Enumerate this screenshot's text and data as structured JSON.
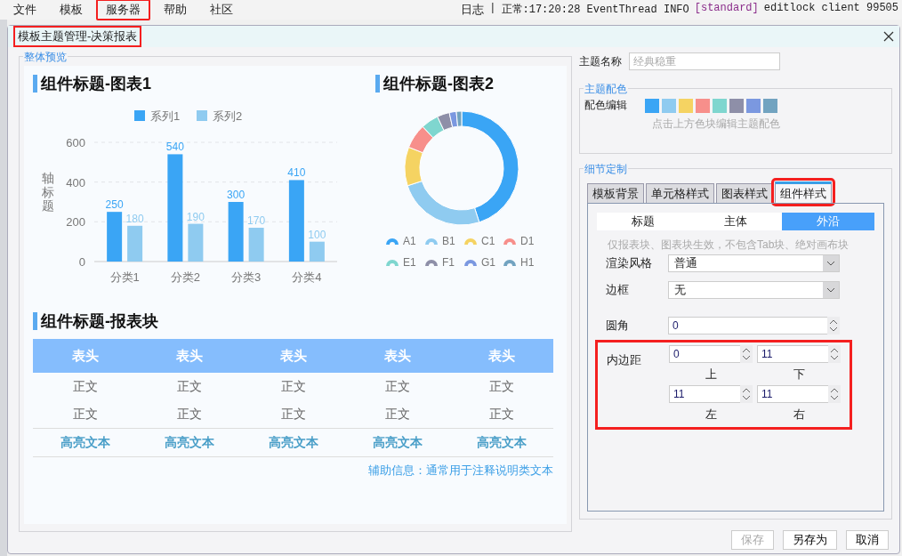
{
  "menu": {
    "items": [
      {
        "label": "文件",
        "highlighted": false
      },
      {
        "label": "模板",
        "highlighted": false
      },
      {
        "label": "服务器",
        "highlighted": true
      },
      {
        "label": "帮助",
        "highlighted": false
      },
      {
        "label": "社区",
        "highlighted": false
      }
    ],
    "log": "日志",
    "status": {
      "separator": "|",
      "prefix": "正常:17:20:28 EventThread INFO",
      "tag": "[standard]",
      "suffix": "editlock client 99505"
    }
  },
  "dialog": {
    "title": "模板主题管理-决策报表",
    "title_highlighted": true
  },
  "preview": {
    "legend": "整体预览",
    "chart1": {
      "title": "组件标题-图表1",
      "chart_data": {
        "type": "bar",
        "ylabel": "轴标题",
        "categories": [
          "分类1",
          "分类2",
          "分类3",
          "分类4"
        ],
        "series": [
          {
            "name": "系列1",
            "color": "#3aa5f5",
            "values": [
              250,
              540,
              300,
              410
            ]
          },
          {
            "name": "系列2",
            "color": "#8fcbf0",
            "values": [
              180,
              190,
              170,
              100
            ]
          }
        ],
        "ylim": [
          0,
          600
        ],
        "yticks": [
          0,
          200,
          400,
          600
        ],
        "data_labels": true,
        "legend": "top"
      }
    },
    "chart2": {
      "title": "组件标题-图表2",
      "legend": [
        {
          "name": "A1",
          "color": "#3aa5f5"
        },
        {
          "name": "B1",
          "color": "#8fcbf0"
        },
        {
          "name": "C1",
          "color": "#f5d362"
        },
        {
          "name": "D1",
          "color": "#f78f8b"
        },
        {
          "name": "E1",
          "color": "#7fd6cf"
        },
        {
          "name": "F1",
          "color": "#8e8fa8"
        },
        {
          "name": "G1",
          "color": "#7b98e0"
        },
        {
          "name": "H1",
          "color": "#72a3c0"
        }
      ]
    },
    "report": {
      "title": "组件标题-报表块",
      "header": [
        "表头",
        "表头",
        "表头",
        "表头",
        "表头"
      ],
      "rows": [
        [
          "正文",
          "正文",
          "正文",
          "正文",
          "正文"
        ],
        [
          "正文",
          "正文",
          "正文",
          "正文",
          "正文"
        ]
      ],
      "highlight_row": [
        "高亮文本",
        "高亮文本",
        "高亮文本",
        "高亮文本",
        "高亮文本"
      ],
      "note": "辅助信息：通常用于注释说明类文本"
    }
  },
  "theme_name": {
    "label": "主题名称",
    "placeholder": "经典稳重"
  },
  "palette": {
    "legend": "主题配色",
    "label": "配色编辑",
    "swatches": [
      {
        "color": "#3aa5f5"
      },
      {
        "color": "#8fcbf0"
      },
      {
        "color": "#f5d362"
      },
      {
        "color": "#f78f8b"
      },
      {
        "color": "#7fd6cf"
      },
      {
        "color": "#8e8fa8"
      },
      {
        "color": "#7b98e0"
      },
      {
        "color": "#72a3c0"
      }
    ],
    "hint": "点击上方色块编辑主题配色"
  },
  "detail": {
    "legend": "细节定制",
    "tabs": [
      {
        "label": "模板背景",
        "selected": false,
        "highlighted": false
      },
      {
        "label": "单元格样式",
        "selected": false,
        "highlighted": false
      },
      {
        "label": "图表样式",
        "selected": false,
        "highlighted": false
      },
      {
        "label": "组件样式",
        "selected": true,
        "highlighted": true
      }
    ],
    "subtabs": [
      {
        "label": "标题",
        "selected": false
      },
      {
        "label": "主体",
        "selected": false
      },
      {
        "label": "外沿",
        "selected": true
      }
    ],
    "hint": "仅报表块、图表块生效，不包含Tab块、绝对画布块",
    "render": {
      "label": "渲染风格",
      "value": "普通"
    },
    "border": {
      "label": "边框",
      "value": "无"
    },
    "radius": {
      "label": "圆角",
      "value": "0"
    },
    "padding": {
      "label": "内边距",
      "highlighted": true,
      "fields": [
        {
          "value": "0",
          "caption": "上"
        },
        {
          "value": "11",
          "caption": "下"
        },
        {
          "value": "11",
          "caption": "左"
        },
        {
          "value": "11",
          "caption": "右"
        }
      ]
    }
  },
  "buttons": [
    {
      "label": "保存",
      "disabled": true
    },
    {
      "label": "另存为",
      "disabled": false
    },
    {
      "label": "取消",
      "disabled": false
    }
  ]
}
